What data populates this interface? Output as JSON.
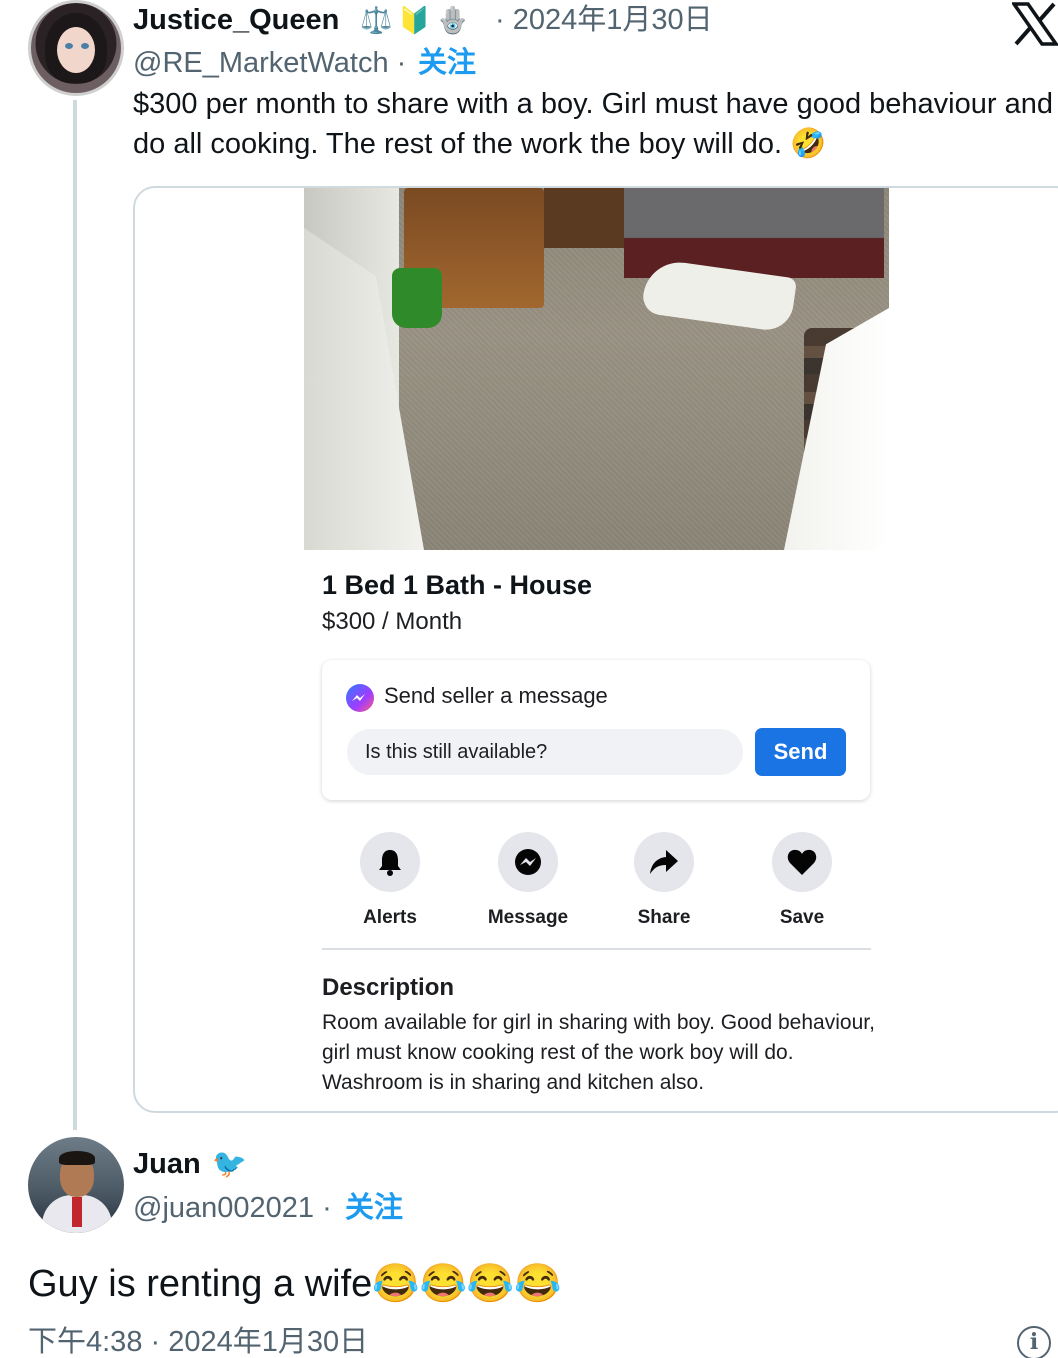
{
  "tweet": {
    "author_name": "Justice_Queen",
    "badges": [
      "⚖️",
      "🔰",
      "🪬"
    ],
    "date": "· 2024年1月30日",
    "handle": "@RE_MarketWatch ·",
    "follow_label": "关注",
    "text": "$300 per month to share with a boy. Girl must have good behaviour and do all cooking. The rest of the work the boy will do. 🤣"
  },
  "listing": {
    "title": "1 Bed 1 Bath - House",
    "price": "$300 / Month",
    "message_box": {
      "label": "Send seller a message",
      "input_value": "Is this still available?",
      "send_label": "Send"
    },
    "actions": [
      {
        "label": "Alerts",
        "icon": "bell-icon"
      },
      {
        "label": "Message",
        "icon": "messenger-icon"
      },
      {
        "label": "Share",
        "icon": "share-arrow-icon"
      },
      {
        "label": "Save",
        "icon": "heart-icon"
      }
    ],
    "description_title": "Description",
    "description_text": "Room available for girl in sharing with boy. Good behaviour, girl must know cooking rest of the work boy will do. Washroom is in sharing and kitchen also."
  },
  "reply": {
    "author_name": "Juan",
    "badge": "🐦",
    "handle": "@juan002021 ·",
    "follow_label": "关注",
    "text": "Guy is renting a wife😂😂😂😂",
    "timestamp": "下午4:38 · 2024年1月30日"
  },
  "colors": {
    "link_blue": "#1d9bf0",
    "send_blue": "#1b74e4",
    "muted_text": "#536471"
  }
}
